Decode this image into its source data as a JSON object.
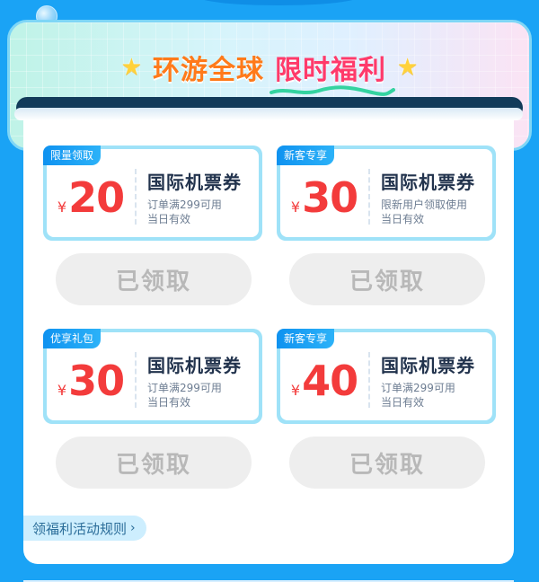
{
  "header": {
    "title_part1": "环游全球",
    "title_part2": "限时福利",
    "star_icon": "star-icon"
  },
  "coupons": [
    {
      "tag": "限量领取",
      "currency": "¥",
      "amount": "20",
      "name": "国际机票券",
      "line1": "订单满299可用",
      "line2": "当日有效",
      "button": "已领取"
    },
    {
      "tag": "新客专享",
      "currency": "¥",
      "amount": "30",
      "name": "国际机票券",
      "line1": "限新用户领取使用",
      "line2": "当日有效",
      "button": "已领取"
    },
    {
      "tag": "优享礼包",
      "currency": "¥",
      "amount": "30",
      "name": "国际机票券",
      "line1": "订单满299可用",
      "line2": "当日有效",
      "button": "已领取"
    },
    {
      "tag": "新客专享",
      "currency": "¥",
      "amount": "40",
      "name": "国际机票券",
      "line1": "订单满299可用",
      "line2": "当日有效",
      "button": "已领取"
    }
  ],
  "footer": {
    "rules_link": "领福利活动规则",
    "chevron_icon": "chevron-right-icon"
  },
  "colors": {
    "background": "#1aa3f5",
    "amount": "#f33b3b",
    "tag": "#0f92f0",
    "title_orange": "#ff7a1a",
    "title_pink": "#ff3a6a",
    "claimed_button": "#eeeeee"
  }
}
